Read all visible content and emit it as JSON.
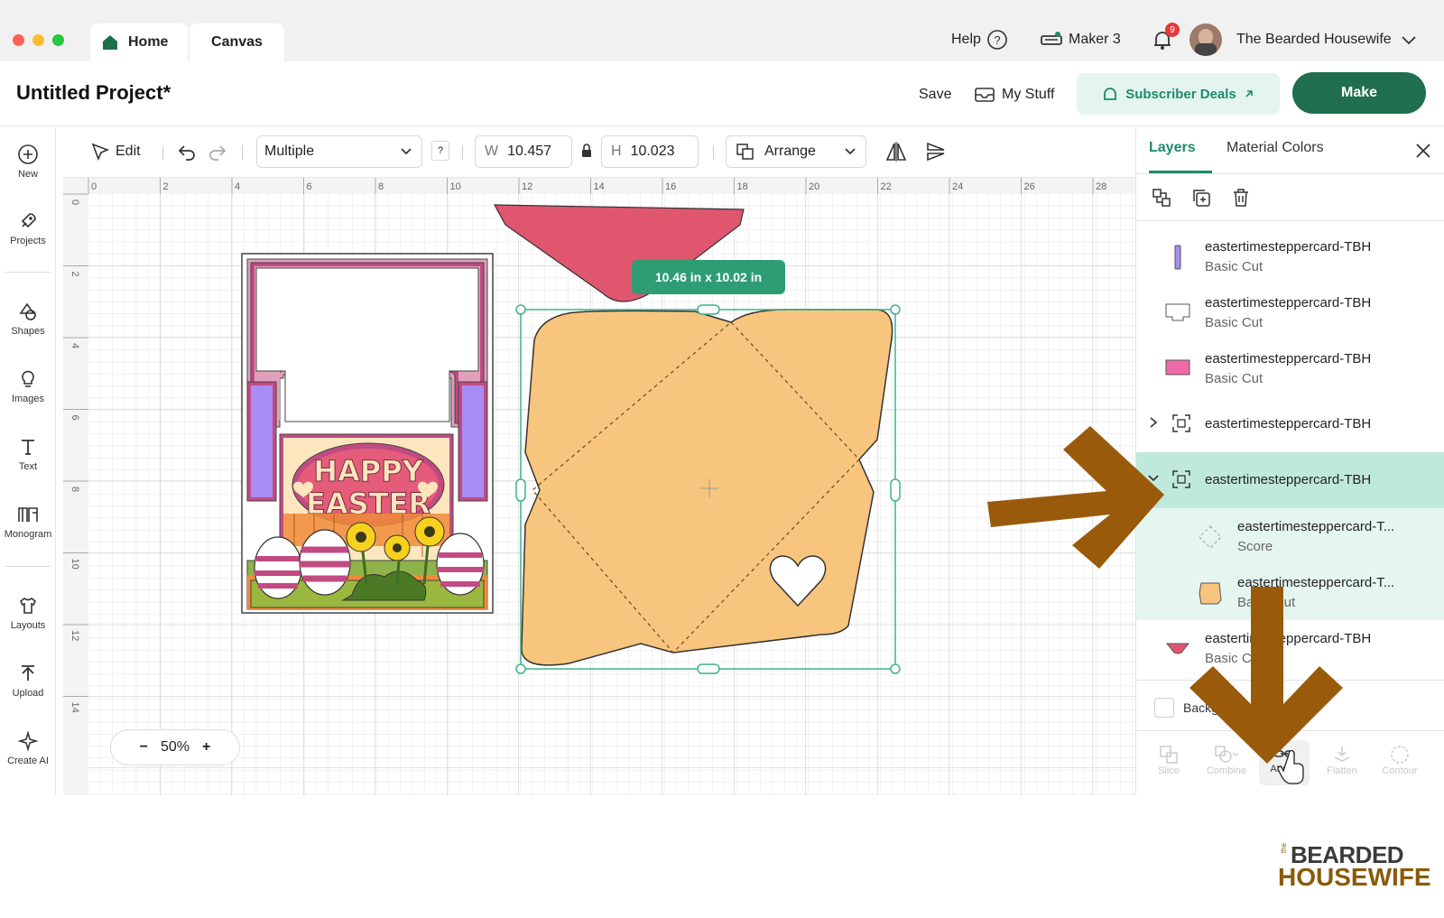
{
  "tabs": {
    "home": "Home",
    "canvas": "Canvas"
  },
  "top": {
    "help": "Help",
    "machine": "Maker 3",
    "notifications": "9",
    "user": "The Bearded Housewife"
  },
  "header": {
    "title": "Untitled Project*",
    "save": "Save",
    "my_stuff": "My Stuff",
    "subscriber_deals": "Subscriber Deals",
    "make": "Make"
  },
  "left_tools": [
    "New",
    "Projects",
    "Shapes",
    "Images",
    "Text",
    "Monogram",
    "Layouts",
    "Upload",
    "Create AI"
  ],
  "edit_bar": {
    "edit": "Edit",
    "operation": "Multiple",
    "help": "?",
    "w_label": "W",
    "w_value": "10.457",
    "h_label": "H",
    "h_value": "10.023",
    "arrange": "Arrange"
  },
  "canvas": {
    "ruler_top": [
      "0",
      "2",
      "4",
      "6",
      "8",
      "10",
      "12",
      "14",
      "16",
      "18",
      "20",
      "22",
      "24",
      "26",
      "28"
    ],
    "ruler_left": [
      "0",
      "2",
      "4",
      "6",
      "8",
      "10",
      "12",
      "14"
    ],
    "dimension_tooltip": "10.46  in x 10.02  in",
    "card_text": [
      "HAPPY",
      "EASTER"
    ],
    "zoom": "50%",
    "zoom_minus": "−",
    "zoom_plus": "+"
  },
  "panel": {
    "tabs": [
      "Layers",
      "Material Colors"
    ],
    "layers": [
      {
        "name": "eastertimesteppercard-TBH",
        "sub": "Basic Cut"
      },
      {
        "name": "eastertimesteppercard-TBH",
        "sub": "Basic Cut"
      },
      {
        "name": "eastertimesteppercard-TBH",
        "sub": "Basic Cut"
      },
      {
        "name": "eastertimesteppercard-TBH"
      },
      {
        "name": "eastertimesteppercard-TBH"
      },
      {
        "name": "eastertimesteppercard-T...",
        "sub": "Score"
      },
      {
        "name": "eastertimesteppercard-T...",
        "sub": "Basic Cut"
      },
      {
        "name": "eastertimesteppercard-TBH",
        "sub": "Basic Cut"
      }
    ],
    "background": "Background",
    "actions": [
      "Slice",
      "Combine",
      "Attach",
      "Flatten",
      "Contour"
    ]
  },
  "brand": {
    "the": "the",
    "line1": "BEARDED",
    "line2": "HOUSEWIFE"
  },
  "colors": {
    "accent": "#1e8a6a",
    "make": "#1f6e4e",
    "envelope": "#f7c57d",
    "flap": "#e0566f",
    "arrow": "#9a5a0c"
  }
}
